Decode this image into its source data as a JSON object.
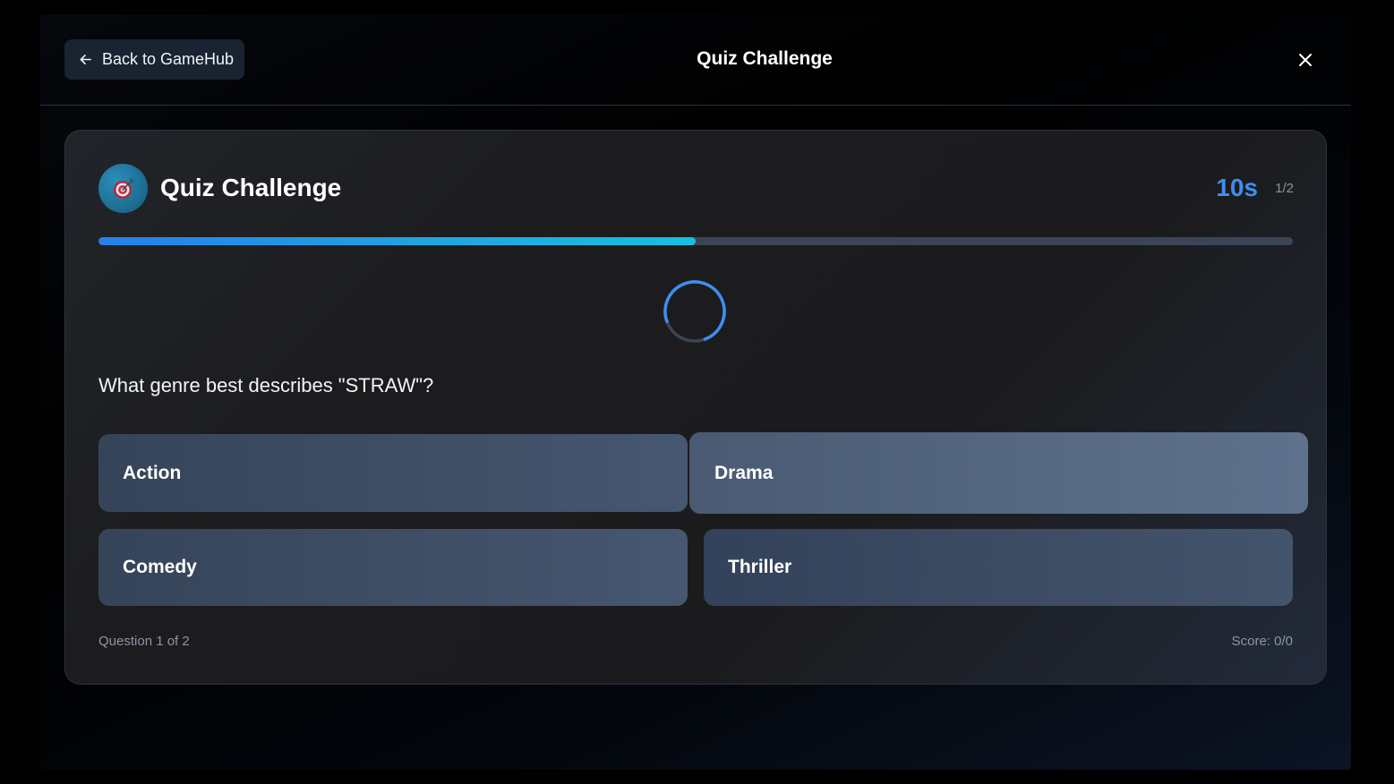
{
  "header": {
    "back_label": "Back to GameHub",
    "title": "Quiz Challenge",
    "back_icon": "arrow-left-icon",
    "close_icon": "close-icon"
  },
  "quiz": {
    "title": "Quiz Challenge",
    "avatar_icon": "target-icon",
    "timer": "10s",
    "counter": "1/2",
    "progress": 0.5,
    "loading": true,
    "question": "What genre best describes \"STRAW\"?",
    "answers": [
      "Action",
      "Drama",
      "Comedy",
      "Thriller"
    ],
    "highlighted_answer": "Drama",
    "footer_left": "Question 1 of 2",
    "footer_right": "Score: 0/0"
  },
  "colors": {
    "accent": "#3d8ff0",
    "progress_start": "#2680e8",
    "progress_end": "#14c1df",
    "answer_bg": "#3d4c64",
    "answer_highlight": "#566781"
  }
}
